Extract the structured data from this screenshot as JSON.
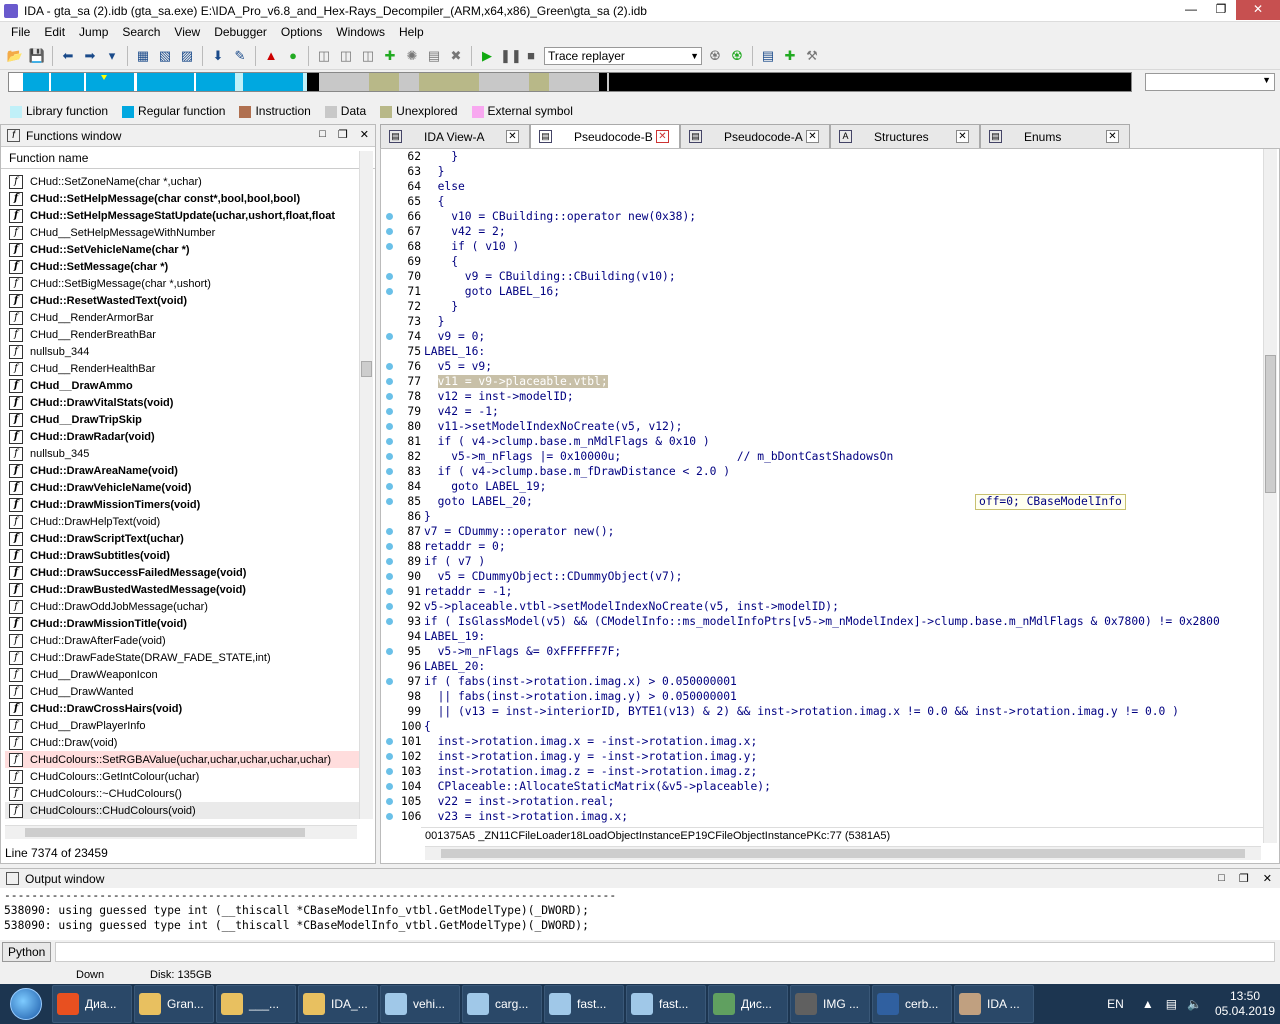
{
  "window": {
    "title": "IDA - gta_sa (2).idb (gta_sa.exe) E:\\IDA_Pro_v6.8_and_Hex-Rays_Decompiler_(ARM,x64,x86)_Green\\gta_sa (2).idb"
  },
  "menu": [
    "File",
    "Edit",
    "Jump",
    "Search",
    "View",
    "Debugger",
    "Options",
    "Windows",
    "Help"
  ],
  "toolbar": {
    "debugger_combo": "Trace replayer"
  },
  "legend": [
    {
      "label": "Library function",
      "color": "#c0f0f8"
    },
    {
      "label": "Regular function",
      "color": "#00a8e0"
    },
    {
      "label": "Instruction",
      "color": "#b07050"
    },
    {
      "label": "Data",
      "color": "#c8c8c8"
    },
    {
      "label": "Unexplored",
      "color": "#b8b888"
    },
    {
      "label": "External symbol",
      "color": "#f8a8f0"
    }
  ],
  "functions_window": {
    "title": "Functions window",
    "column": "Function name",
    "status": "Line 7374 of 23459",
    "items": [
      {
        "name": "CHud::SetZoneName(char *,uchar)",
        "bold": false
      },
      {
        "name": "CHud::SetHelpMessage(char const*,bool,bool,bool)",
        "bold": true
      },
      {
        "name": "CHud::SetHelpMessageStatUpdate(uchar,ushort,float,float",
        "bold": true
      },
      {
        "name": "CHud__SetHelpMessageWithNumber",
        "bold": false
      },
      {
        "name": "CHud::SetVehicleName(char *)",
        "bold": true
      },
      {
        "name": "CHud::SetMessage(char *)",
        "bold": true
      },
      {
        "name": "CHud::SetBigMessage(char *,ushort)",
        "bold": false
      },
      {
        "name": "CHud::ResetWastedText(void)",
        "bold": true
      },
      {
        "name": "CHud__RenderArmorBar",
        "bold": false
      },
      {
        "name": "CHud__RenderBreathBar",
        "bold": false
      },
      {
        "name": "nullsub_344",
        "bold": false
      },
      {
        "name": "CHud__RenderHealthBar",
        "bold": false
      },
      {
        "name": "CHud__DrawAmmo",
        "bold": true
      },
      {
        "name": "CHud::DrawVitalStats(void)",
        "bold": true
      },
      {
        "name": "CHud__DrawTripSkip",
        "bold": true
      },
      {
        "name": "CHud::DrawRadar(void)",
        "bold": true
      },
      {
        "name": "nullsub_345",
        "bold": false
      },
      {
        "name": "CHud::DrawAreaName(void)",
        "bold": true
      },
      {
        "name": "CHud::DrawVehicleName(void)",
        "bold": true
      },
      {
        "name": "CHud::DrawMissionTimers(void)",
        "bold": true
      },
      {
        "name": "CHud::DrawHelpText(void)",
        "bold": false
      },
      {
        "name": "CHud::DrawScriptText(uchar)",
        "bold": true
      },
      {
        "name": "CHud::DrawSubtitles(void)",
        "bold": true
      },
      {
        "name": "CHud::DrawSuccessFailedMessage(void)",
        "bold": true
      },
      {
        "name": "CHud::DrawBustedWastedMessage(void)",
        "bold": true
      },
      {
        "name": "CHud::DrawOddJobMessage(uchar)",
        "bold": false
      },
      {
        "name": "CHud::DrawMissionTitle(void)",
        "bold": true
      },
      {
        "name": "CHud::DrawAfterFade(void)",
        "bold": false
      },
      {
        "name": "CHud::DrawFadeState(DRAW_FADE_STATE,int)",
        "bold": false
      },
      {
        "name": "CHud__DrawWeaponIcon",
        "bold": false
      },
      {
        "name": "CHud__DrawWanted",
        "bold": false
      },
      {
        "name": "CHud::DrawCrossHairs(void)",
        "bold": true
      },
      {
        "name": "CHud__DrawPlayerInfo",
        "bold": false
      },
      {
        "name": "CHud::Draw(void)",
        "bold": false
      },
      {
        "name": "CHudColours::SetRGBAValue(uchar,uchar,uchar,uchar,uchar)",
        "bold": false,
        "selected": true
      },
      {
        "name": "CHudColours::GetIntColour(uchar)",
        "bold": false
      },
      {
        "name": "CHudColours::~CHudColours()",
        "bold": false
      },
      {
        "name": "CHudColours::CHudColours(void)",
        "bold": false,
        "current": true
      }
    ]
  },
  "tabs": [
    {
      "label": "IDA View-A",
      "active": false
    },
    {
      "label": "Pseudocode-B",
      "active": true
    },
    {
      "label": "Pseudocode-A",
      "active": false
    },
    {
      "label": "Structures",
      "active": false
    },
    {
      "label": "Enums",
      "active": false
    }
  ],
  "code": {
    "lines": [
      {
        "n": "62",
        "dot": false,
        "t": "    }"
      },
      {
        "n": "63",
        "dot": false,
        "t": "  }"
      },
      {
        "n": "64",
        "dot": false,
        "t": "  else"
      },
      {
        "n": "65",
        "dot": false,
        "t": "  {"
      },
      {
        "n": "66",
        "dot": true,
        "t": "    v10 = CBuilding::operator new(0x38);"
      },
      {
        "n": "67",
        "dot": true,
        "t": "    v42 = 2;"
      },
      {
        "n": "68",
        "dot": true,
        "t": "    if ( v10 )"
      },
      {
        "n": "69",
        "dot": false,
        "t": "    {"
      },
      {
        "n": "70",
        "dot": true,
        "t": "      v9 = CBuilding::CBuilding(v10);"
      },
      {
        "n": "71",
        "dot": true,
        "t": "      goto LABEL_16;"
      },
      {
        "n": "72",
        "dot": false,
        "t": "    }"
      },
      {
        "n": "73",
        "dot": false,
        "t": "  }"
      },
      {
        "n": "74",
        "dot": true,
        "t": "  v9 = 0;"
      },
      {
        "n": "75",
        "dot": false,
        "t": "LABEL_16:"
      },
      {
        "n": "76",
        "dot": true,
        "t": "  v5 = v9;"
      },
      {
        "n": "77",
        "dot": true,
        "t": "  v11 = v9->placeable.vtbl;",
        "hl": true
      },
      {
        "n": "78",
        "dot": true,
        "t": "  v12 = inst->modelID;"
      },
      {
        "n": "79",
        "dot": true,
        "t": "  v42 = -1;"
      },
      {
        "n": "80",
        "dot": true,
        "t": "  v11->setModelIndexNoCreate(v5, v12);"
      },
      {
        "n": "81",
        "dot": true,
        "t": "  if ( v4->clump.base.m_nMdlFlags & 0x10 )"
      },
      {
        "n": "82",
        "dot": true,
        "t": "    v5->m_nFlags |= 0x10000u;                 // m_bDontCastShadowsOn"
      },
      {
        "n": "83",
        "dot": true,
        "t": "  if ( v4->clump.base.m_fDrawDistance < 2.0 )"
      },
      {
        "n": "84",
        "dot": true,
        "t": "    goto LABEL_19;"
      },
      {
        "n": "85",
        "dot": true,
        "t": "  goto LABEL_20;"
      },
      {
        "n": "86",
        "dot": false,
        "t": "}"
      },
      {
        "n": "87",
        "dot": true,
        "t": "v7 = CDummy::operator new();"
      },
      {
        "n": "88",
        "dot": true,
        "t": "retaddr = 0;"
      },
      {
        "n": "89",
        "dot": true,
        "t": "if ( v7 )"
      },
      {
        "n": "90",
        "dot": true,
        "t": "  v5 = CDummyObject::CDummyObject(v7);"
      },
      {
        "n": "91",
        "dot": true,
        "t": "retaddr = -1;"
      },
      {
        "n": "92",
        "dot": true,
        "t": "v5->placeable.vtbl->setModelIndexNoCreate(v5, inst->modelID);"
      },
      {
        "n": "93",
        "dot": true,
        "t": "if ( IsGlassModel(v5) && (CModelInfo::ms_modelInfoPtrs[v5->m_nModelIndex]->clump.base.m_nMdlFlags & 0x7800) != 0x2800"
      },
      {
        "n": "94",
        "dot": false,
        "t": "LABEL_19:"
      },
      {
        "n": "95",
        "dot": true,
        "t": "  v5->m_nFlags &= 0xFFFFFF7F;"
      },
      {
        "n": "96",
        "dot": false,
        "t": "LABEL_20:"
      },
      {
        "n": "97",
        "dot": true,
        "t": "if ( fabs(inst->rotation.imag.x) > 0.050000001"
      },
      {
        "n": "98",
        "dot": false,
        "t": "  || fabs(inst->rotation.imag.y) > 0.050000001"
      },
      {
        "n": "99",
        "dot": false,
        "t": "  || (v13 = inst->interiorID, BYTE1(v13) & 2) && inst->rotation.imag.x != 0.0 && inst->rotation.imag.y != 0.0 )"
      },
      {
        "n": "100",
        "dot": false,
        "t": "{"
      },
      {
        "n": "101",
        "dot": true,
        "t": "  inst->rotation.imag.x = -inst->rotation.imag.x;"
      },
      {
        "n": "102",
        "dot": true,
        "t": "  inst->rotation.imag.y = -inst->rotation.imag.y;"
      },
      {
        "n": "103",
        "dot": true,
        "t": "  inst->rotation.imag.z = -inst->rotation.imag.z;"
      },
      {
        "n": "104",
        "dot": true,
        "t": "  CPlaceable::AllocateStaticMatrix(&v5->placeable);"
      },
      {
        "n": "105",
        "dot": true,
        "t": "  v22 = inst->rotation.real;"
      },
      {
        "n": "106",
        "dot": true,
        "t": "  v23 = inst->rotation.imag.x;"
      }
    ],
    "tooltip": "off=0; CBaseModelInfo",
    "status": "001375A5  _ZN11CFileLoader18LoadObjectInstanceEP19CFileObjectInstancePKc:77 (5381A5)"
  },
  "output": {
    "title": "Output window",
    "lines": [
      "------------------------------------------------------------------------------------------",
      "538090: using guessed type int (__thiscall *CBaseModelInfo_vtbl.GetModelType)(_DWORD);",
      "538090: using guessed type int (__thiscall *CBaseModelInfo_vtbl.GetModelType)(_DWORD);"
    ],
    "python_button": "Python"
  },
  "statusbar": {
    "state": "Down",
    "disk": "Disk: 135GB"
  },
  "taskbar": {
    "tasks": [
      {
        "label": "Диа...",
        "color": "#e85020"
      },
      {
        "label": "Gran...",
        "color": "#e8c060"
      },
      {
        "label": "___...",
        "color": "#e8c060"
      },
      {
        "label": "IDA_...",
        "color": "#e8c060"
      },
      {
        "label": "vehi...",
        "color": "#a0c8e8"
      },
      {
        "label": "carg...",
        "color": "#a0c8e8"
      },
      {
        "label": "fast...",
        "color": "#a0c8e8"
      },
      {
        "label": "fast...",
        "color": "#a0c8e8"
      },
      {
        "label": "Дис...",
        "color": "#60a060"
      },
      {
        "label": "IMG ...",
        "color": "#606060"
      },
      {
        "label": "cerb...",
        "color": "#3060a0"
      },
      {
        "label": "IDA ...",
        "color": "#c0a080"
      }
    ],
    "lang": "EN",
    "time": "13:50",
    "date": "05.04.2019"
  }
}
